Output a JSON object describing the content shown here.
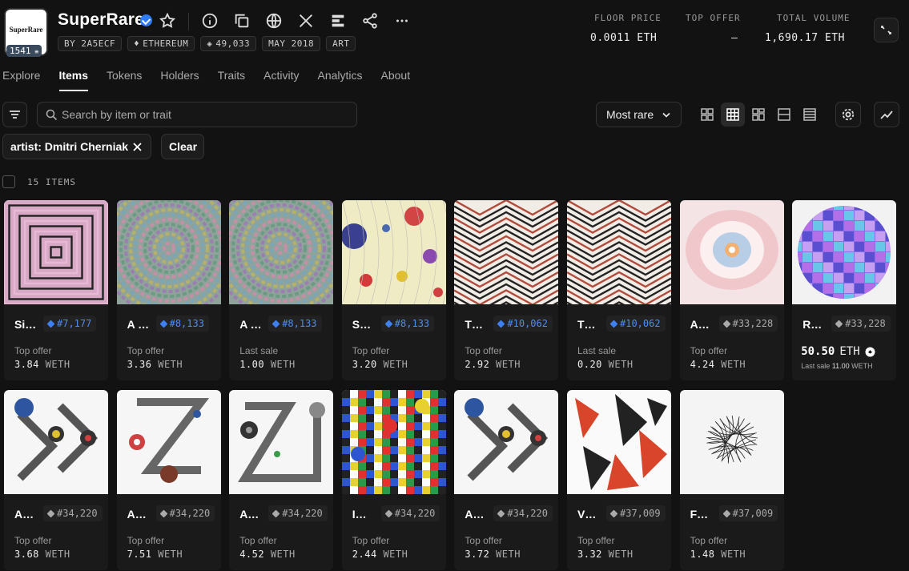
{
  "collection": {
    "name": "SuperRare",
    "logo_text": "SuperRare",
    "logo_badge": "1541",
    "tags": [
      "BY 2A5ECF",
      "ETHEREUM",
      "49,033",
      "MAY 2018",
      "ART"
    ]
  },
  "stats": [
    {
      "label": "FLOOR PRICE",
      "value": "0.0011 ETH"
    },
    {
      "label": "TOP OFFER",
      "value": "–"
    },
    {
      "label": "TOTAL VOLUME",
      "value": "1,690.17 ETH"
    }
  ],
  "tabs": [
    "Explore",
    "Items",
    "Tokens",
    "Holders",
    "Traits",
    "Activity",
    "Analytics",
    "About"
  ],
  "active_tab": "Items",
  "search": {
    "placeholder": "Search by item or trait"
  },
  "sort": {
    "label": "Most rare"
  },
  "filters": {
    "chip": "artist: Dmitri Cherniak",
    "clear": "Clear"
  },
  "item_count": "15 ITEMS",
  "items": [
    {
      "name": "Si…",
      "rank": "#7,177",
      "label": "Top offer",
      "value": "3.84",
      "currency": "WETH",
      "art": "squares"
    },
    {
      "name": "A …",
      "rank": "#8,133",
      "label": "Top offer",
      "value": "3.36",
      "currency": "WETH",
      "art": "swirl"
    },
    {
      "name": "A …",
      "rank": "#8,133",
      "label": "Last sale",
      "value": "1.00",
      "currency": "WETH",
      "art": "swirl"
    },
    {
      "name": "S…",
      "rank": "#8,133",
      "label": "Top offer",
      "value": "3.20",
      "currency": "WETH",
      "art": "dots"
    },
    {
      "name": "T…",
      "rank": "#10,062",
      "label": "Top offer",
      "value": "2.92",
      "currency": "WETH",
      "art": "zigzag"
    },
    {
      "name": "T…",
      "rank": "#10,062",
      "label": "Last sale",
      "value": "0.20",
      "currency": "WETH",
      "art": "zigzag"
    },
    {
      "name": "A…",
      "rank": "#33,228",
      "label": "Top offer",
      "value": "4.24",
      "currency": "WETH",
      "art": "eye"
    },
    {
      "name": "R…",
      "rank": "#33,228",
      "price": "50.50",
      "price_currency": "ETH",
      "last_sale_label": "Last sale",
      "last_sale_value": "11.00",
      "last_sale_currency": "WETH",
      "art": "cubes"
    },
    {
      "name": "A…",
      "rank": "#34,220",
      "label": "Top offer",
      "value": "3.68",
      "currency": "WETH",
      "art": "ring1"
    },
    {
      "name": "A…",
      "rank": "#34,220",
      "label": "Top offer",
      "value": "7.51",
      "currency": "WETH",
      "art": "ring2"
    },
    {
      "name": "A…",
      "rank": "#34,220",
      "label": "Top offer",
      "value": "4.52",
      "currency": "WETH",
      "art": "ring3"
    },
    {
      "name": "I…",
      "rank": "#34,220",
      "label": "Top offer",
      "value": "2.44",
      "currency": "WETH",
      "art": "mosaic"
    },
    {
      "name": "A…",
      "rank": "#34,220",
      "label": "Top offer",
      "value": "3.72",
      "currency": "WETH",
      "art": "ring1"
    },
    {
      "name": "V…",
      "rank": "#37,009",
      "label": "Top offer",
      "value": "3.32",
      "currency": "WETH",
      "art": "shards"
    },
    {
      "name": "F…",
      "rank": "#37,009",
      "label": "Top offer",
      "value": "1.48",
      "currency": "WETH",
      "art": "scribble"
    }
  ],
  "colors": {
    "accent": "#2f7bf5",
    "rank_blue": "#4d8cf5",
    "background": "#121212",
    "card": "#1a1a1a"
  }
}
